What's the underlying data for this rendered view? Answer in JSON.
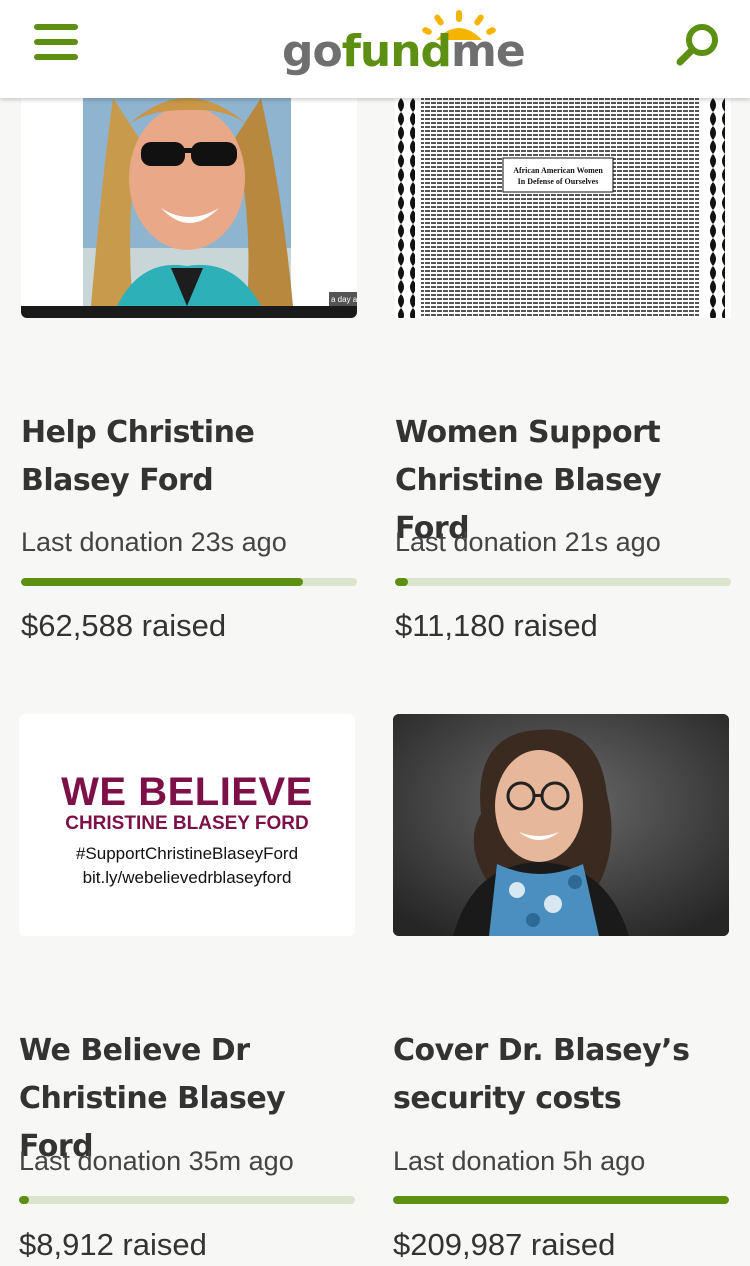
{
  "header": {
    "logo_go": "go",
    "logo_fund": "fund",
    "logo_me": "me",
    "menu_icon": "hamburger-icon",
    "search_icon": "search-icon"
  },
  "colors": {
    "brand_green": "#5c8f12",
    "progress_track": "#dde4cd",
    "believe_maroon": "#7d1046"
  },
  "campaigns": [
    {
      "title": "Help Christine Blasey Ford",
      "last_donation": "Last donation 23s ago",
      "raised": "$62,588 raised",
      "progress": 0.84,
      "image_caption": "a day ag"
    },
    {
      "title": "Women Support Christine Blasey Ford",
      "last_donation": "Last donation 21s ago",
      "raised": "$11,180 raised",
      "progress": 0.04,
      "image_heading": "African American Women In Defense of Ourselves"
    },
    {
      "title": "We Believe Dr Christine Blasey Ford",
      "last_donation": "Last donation 35m ago",
      "raised": "$8,912 raised",
      "progress": 0.03,
      "image_line1": "WE BELIEVE",
      "image_line2": "CHRISTINE BLASEY FORD",
      "image_line3": "#SupportChristineBlaseyFord",
      "image_line4": "bit.ly/webelievedrblaseyford"
    },
    {
      "title": "Cover Dr. Blasey’s security costs",
      "last_donation": "Last donation 5h ago",
      "raised": "$209,987 raised",
      "progress": 1.0
    }
  ]
}
